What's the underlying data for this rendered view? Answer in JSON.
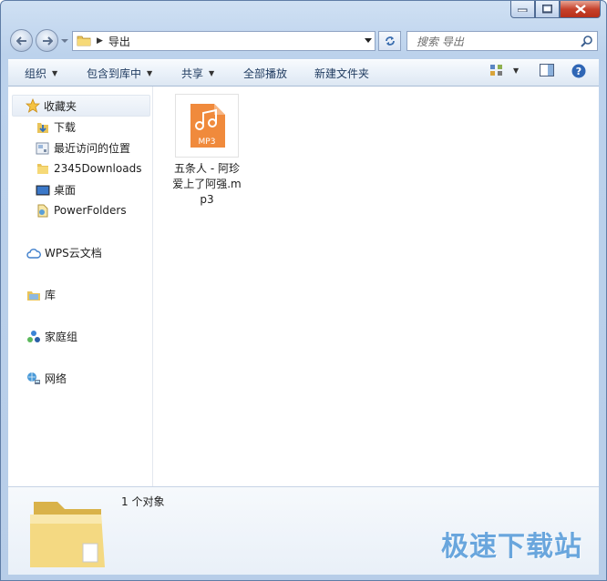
{
  "window": {
    "caption_buttons": [
      "minimize",
      "maximize",
      "close"
    ]
  },
  "address_bar": {
    "path": "导出",
    "search_placeholder": "搜索 导出"
  },
  "toolbar": {
    "organize": "组织",
    "include_in_library": "包含到库中",
    "share": "共享",
    "play_all": "全部播放",
    "new_folder": "新建文件夹"
  },
  "nav_pane": {
    "favorites": "收藏夹",
    "favorite_items": [
      {
        "label": "下载",
        "icon": "download-folder-icon"
      },
      {
        "label": "最近访问的位置",
        "icon": "recent-places-icon"
      },
      {
        "label": "2345Downloads",
        "icon": "folder-icon"
      },
      {
        "label": "桌面",
        "icon": "desktop-icon"
      },
      {
        "label": "PowerFolders",
        "icon": "power-folder-icon"
      }
    ],
    "wps_cloud": "WPS云文档",
    "libraries": "库",
    "homegroup": "家庭组",
    "network": "网络"
  },
  "files": [
    {
      "name": "五条人 - 阿珍爱上了阿强.mp3",
      "badge": "MP3",
      "icon": "mp3-file-icon"
    }
  ],
  "details_pane": {
    "item_count": "1 个对象"
  },
  "watermark": "极速下载站",
  "colors": {
    "mp3_orange": "#f08a3c",
    "selection_blue": "#e6edf6",
    "window_frame": "#bcd2ec"
  }
}
